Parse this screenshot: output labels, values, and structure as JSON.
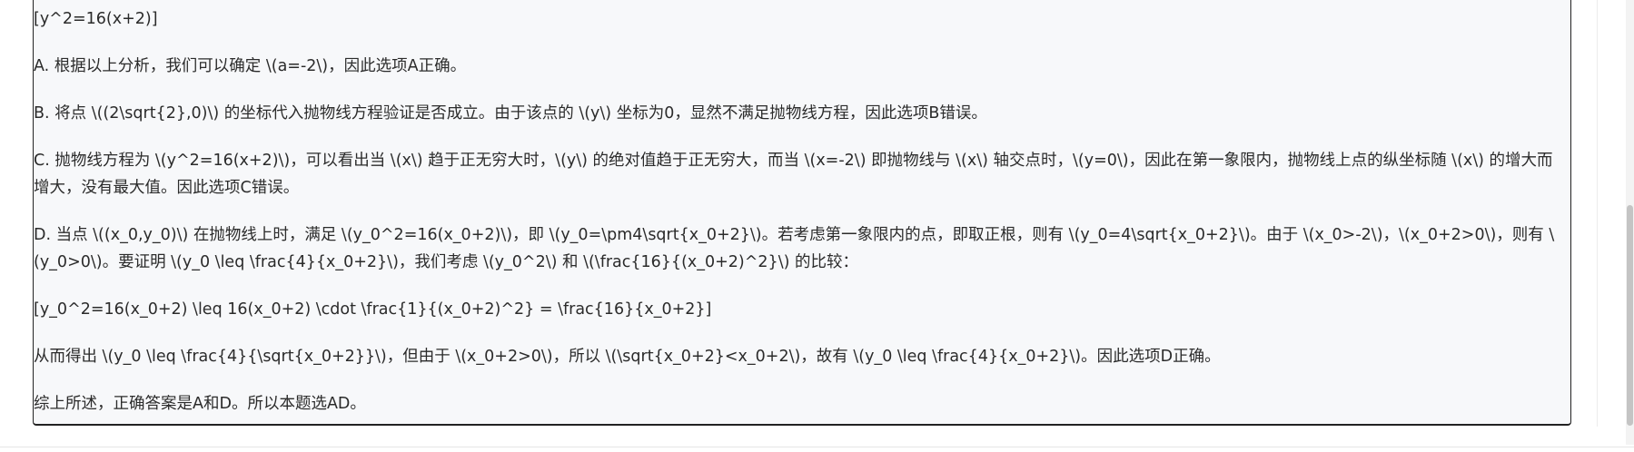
{
  "solution": {
    "lines": [
      "[y^2=16(x+2)]",
      "A. 根据以上分析，我们可以确定 \\(a=-2\\)，因此选项A正确。",
      "B. 将点 \\((2\\sqrt{2},0)\\) 的坐标代入抛物线方程验证是否成立。由于该点的 \\(y\\) 坐标为0，显然不满足抛物线方程，因此选项B错误。",
      "C. 抛物线方程为 \\(y^2=16(x+2)\\)，可以看出当 \\(x\\) 趋于正无穷大时，\\(y\\) 的绝对值趋于正无穷大，而当 \\(x=-2\\) 即抛物线与 \\(x\\) 轴交点时，\\(y=0\\)，因此在第一象限内，抛物线上点的纵坐标随 \\(x\\) 的增大而增大，没有最大值。因此选项C错误。",
      "D. 当点 \\((x_0,y_0)\\) 在抛物线上时，满足 \\(y_0^2=16(x_0+2)\\)，即 \\(y_0=\\pm4\\sqrt{x_0+2}\\)。若考虑第一象限内的点，即取正根，则有 \\(y_0=4\\sqrt{x_0+2}\\)。由于 \\(x_0>-2\\)，\\(x_0+2>0\\)，则有 \\(y_0>0\\)。要证明 \\(y_0 \\leq \\frac{4}{x_0+2}\\)，我们考虑 \\(y_0^2\\) 和 \\(\\frac{16}{(x_0+2)^2}\\) 的比较：",
      "[y_0^2=16(x_0+2) \\leq 16(x_0+2) \\cdot \\frac{1}{(x_0+2)^2} = \\frac{16}{x_0+2}]",
      "从而得出 \\(y_0 \\leq \\frac{4}{\\sqrt{x_0+2}}\\)，但由于 \\(x_0+2>0\\)，所以 \\(\\sqrt{x_0+2}<x_0+2\\)，故有 \\(y_0 \\leq \\frac{4}{x_0+2}\\)。因此选项D正确。",
      "综上所述，正确答案是A和D。所以本题选AD。"
    ]
  }
}
